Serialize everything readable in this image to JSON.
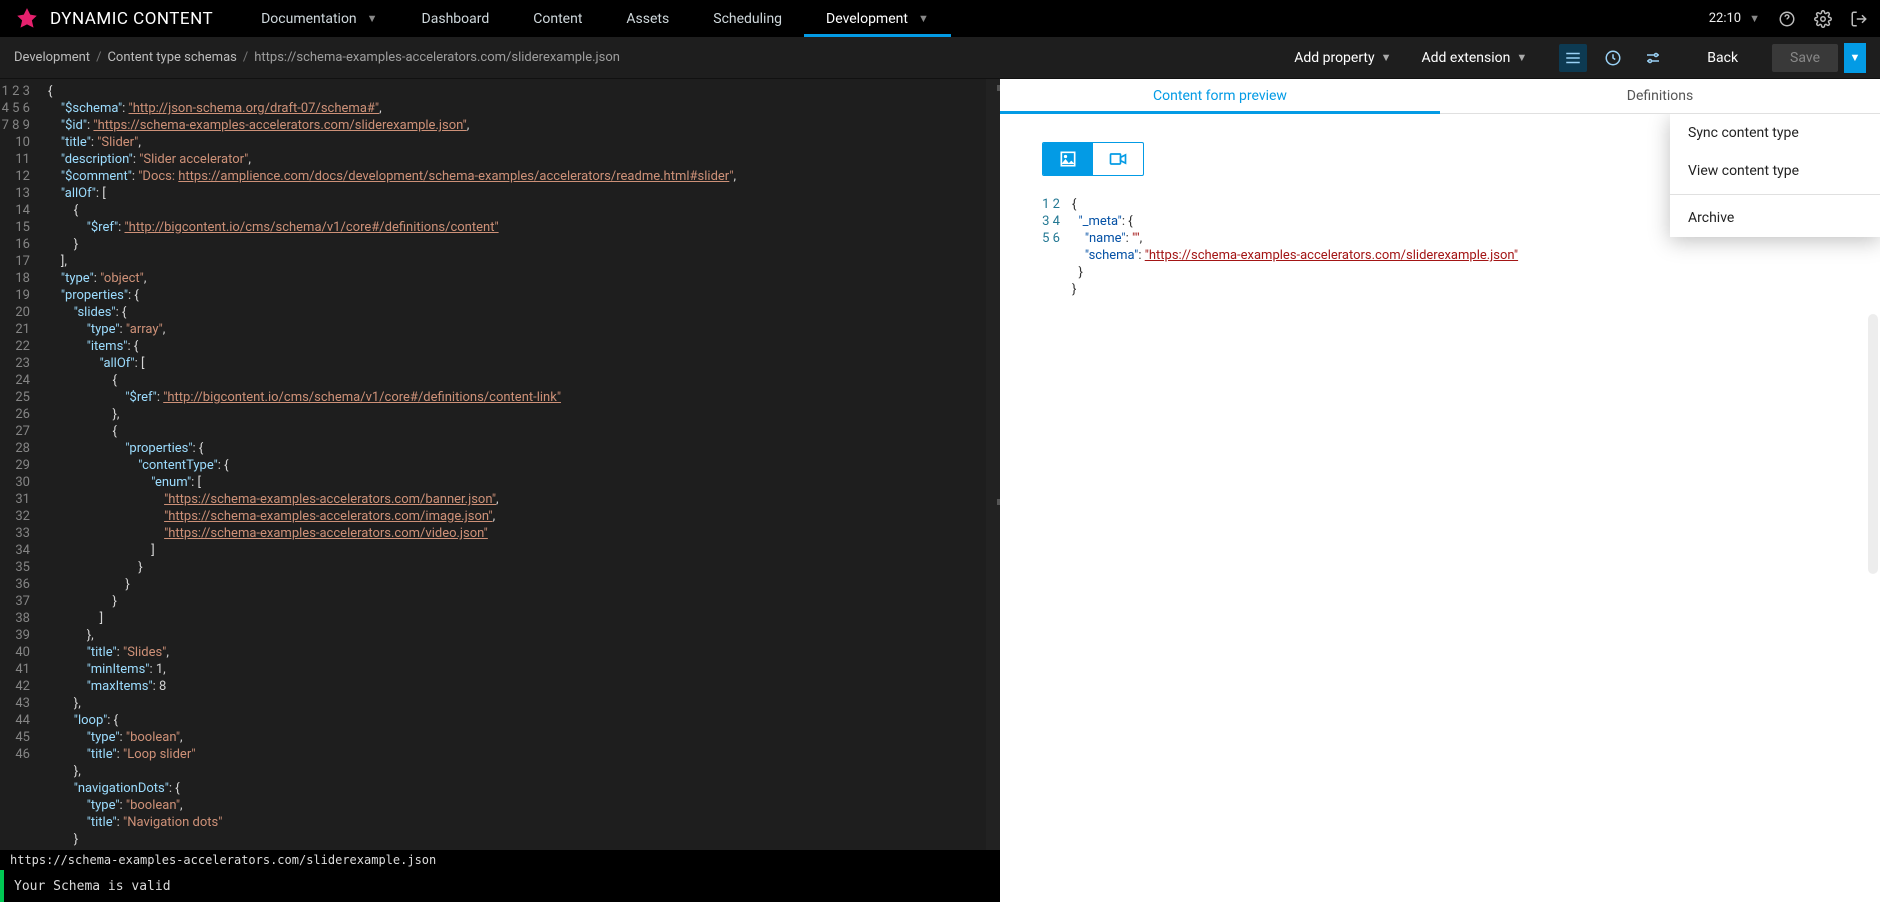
{
  "header": {
    "brand": "DYNAMIC CONTENT",
    "nav": [
      {
        "label": "Documentation",
        "caret": true
      },
      {
        "label": "Dashboard"
      },
      {
        "label": "Content"
      },
      {
        "label": "Assets"
      },
      {
        "label": "Scheduling"
      },
      {
        "label": "Development",
        "active": true,
        "caret": true
      }
    ],
    "clock": "22:10"
  },
  "crumbbar": {
    "crumbs": [
      {
        "label": "Development",
        "link": true
      },
      {
        "label": "Content type schemas",
        "link": true
      },
      {
        "label": "https://schema-examples-accelerators.com/sliderexample.json"
      }
    ],
    "add_property": "Add property",
    "add_extension": "Add extension",
    "back_label": "Back",
    "save_label": "Save"
  },
  "dropdown": {
    "sync": "Sync content type",
    "view": "View content type",
    "archive": "Archive"
  },
  "status": {
    "url": "https://schema-examples-accelerators.com/sliderexample.json",
    "valid": "Your Schema is valid"
  },
  "right": {
    "tabs": {
      "preview": "Content form preview",
      "defs": "Definitions"
    }
  },
  "editor": {
    "line_count": 46,
    "schema": {
      "$schema": "http://json-schema.org/draft-07/schema#",
      "$id": "https://schema-examples-accelerators.com/sliderexample.json",
      "title": "Slider",
      "description": "Slider accelerator",
      "$comment": "Docs: https://amplience.com/docs/development/schema-examples/accelerators/readme.html#slider",
      "allOf_ref": "http://bigcontent.io/cms/schema/v1/core#/definitions/content",
      "type": "object",
      "slides": {
        "type": "array",
        "item_ref": "http://bigcontent.io/cms/schema/v1/core#/definitions/content-link",
        "enum": [
          "https://schema-examples-accelerators.com/banner.json",
          "https://schema-examples-accelerators.com/image.json",
          "https://schema-examples-accelerators.com/video.json"
        ],
        "title": "Slides",
        "minItems": 1,
        "maxItems": 8
      },
      "loop": {
        "type": "boolean",
        "title": "Loop slider"
      },
      "navigationDots": {
        "type": "boolean",
        "title": "Navigation dots"
      }
    }
  },
  "preview": {
    "line_count": 6,
    "json": {
      "meta_name": "",
      "meta_schema": "https://schema-examples-accelerators.com/sliderexample.json"
    }
  }
}
